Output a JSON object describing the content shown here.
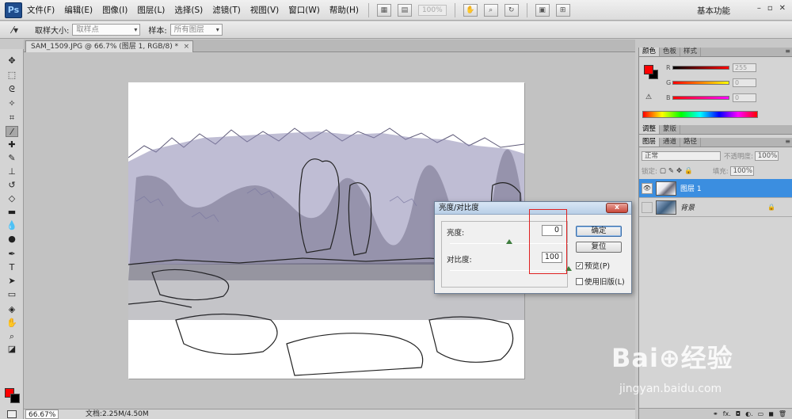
{
  "app": {
    "logo": "Ps",
    "workspace": "基本功能"
  },
  "menu": [
    "文件(F)",
    "编辑(E)",
    "图像(I)",
    "图层(L)",
    "选择(S)",
    "滤镜(T)",
    "视图(V)",
    "窗口(W)",
    "帮助(H)"
  ],
  "menubar_zoom": "100%",
  "options": {
    "sample_size_label": "取样大小:",
    "sample_size_value": "取样点",
    "sample_label": "样本:",
    "sample_value": "所有图层"
  },
  "document": {
    "tab_title": "SAM_1509.JPG @ 66.7% (图层 1, RGB/8) *",
    "close": "×"
  },
  "status": {
    "zoom": "66.67%",
    "doc_info": "文档:2.25M/4.50M"
  },
  "dialog": {
    "title": "亮度/对比度",
    "close": "x",
    "brightness_label": "亮度:",
    "brightness_value": "0",
    "contrast_label": "对比度:",
    "contrast_value": "100",
    "brightness_level": 0.5,
    "contrast_level": 1.0,
    "ok_button": "确定",
    "reset_button": "复位",
    "preview_label": "预览(P)",
    "preview_checked": true,
    "legacy_label": "使用旧版(L)",
    "legacy_checked": false
  },
  "panels": {
    "color_tabs": [
      "颜色",
      "色板",
      "样式"
    ],
    "color_values": [
      "255",
      "0",
      "0"
    ],
    "adjust_tabs": [
      "调整",
      "蒙版"
    ],
    "layer_tabs": [
      "图层",
      "通道",
      "路径"
    ],
    "blend_mode": "正常",
    "opacity_label": "不透明度:",
    "opacity_value": "100%",
    "lock_label": "锁定:",
    "fill_label": "填充:",
    "fill_value": "100%",
    "layers": [
      {
        "name": "图层 1",
        "selected": true
      },
      {
        "name": "背景",
        "selected": false
      }
    ],
    "bottom_icons": [
      "fx.",
      "◘",
      "◐.",
      "▭",
      "◼",
      "🗑"
    ]
  },
  "watermark": {
    "text": "Bai⊕经验",
    "url": "jingyan.baidu.com"
  },
  "colors": {
    "foreground": "#ff0000",
    "background": "#000000",
    "selection": "#3b8ee0"
  }
}
